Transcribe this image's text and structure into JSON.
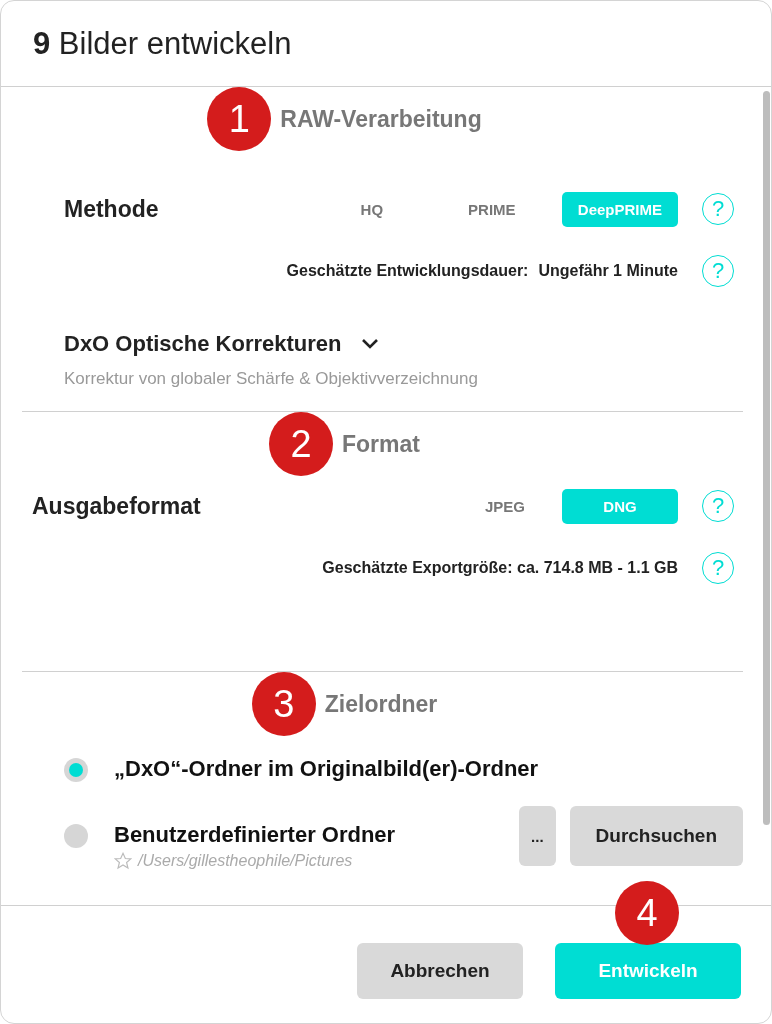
{
  "dialog": {
    "title": "**9** Bilder entwickeln"
  },
  "sections": [
    {
      "badge": "1",
      "heading": "RAW-Verarbeitung",
      "rows": [
        {
          "kind": "segmented",
          "label": "Methode",
          "options": [
            {
              "label": "HQ",
              "selected": false
            },
            {
              "label": "PRIME",
              "selected": false
            },
            {
              "label": "DeepPRIME",
              "selected": true
            }
          ],
          "help": "?"
        },
        {
          "kind": "info",
          "label": "Geschätzte Entwicklungsdauer:",
          "value": "Ungefähr 1 Minute",
          "help": "?"
        },
        {
          "kind": "expander",
          "title": "DxO Optische Korrekturen",
          "subtitle": "Korrektur von globaler Schärfe & Objektivverzeichnung",
          "expanded": false
        }
      ]
    },
    {
      "badge": "2",
      "heading": "Format",
      "rows": [
        {
          "kind": "segmented",
          "label": "Ausgabeformat",
          "options": [
            {
              "label": "JPEG",
              "selected": false
            },
            {
              "label": "DNG",
              "selected": true
            }
          ],
          "help": "?"
        },
        {
          "kind": "info",
          "label": "Geschätzte Exportgröße: ca. 714.8 MB - 1.1 GB",
          "help": "?"
        }
      ]
    },
    {
      "badge": "3",
      "heading": "Zielordner",
      "rows": [
        {
          "kind": "radio",
          "label": "„DxO“-Ordner im Originalbild(er)-Ordner",
          "selected": true
        },
        {
          "kind": "radio",
          "label": "Benutzerdefinierter Ordner",
          "selected": false,
          "path": "/Users/gillestheophile/Pictures",
          "buttons": [
            "...",
            "Durchsuchen"
          ]
        }
      ]
    }
  ],
  "footer": {
    "badge": "4",
    "buttons": [
      {
        "label": "Abbrechen",
        "kind": "secondary"
      },
      {
        "label": "Entwickeln",
        "kind": "primary"
      }
    ]
  }
}
